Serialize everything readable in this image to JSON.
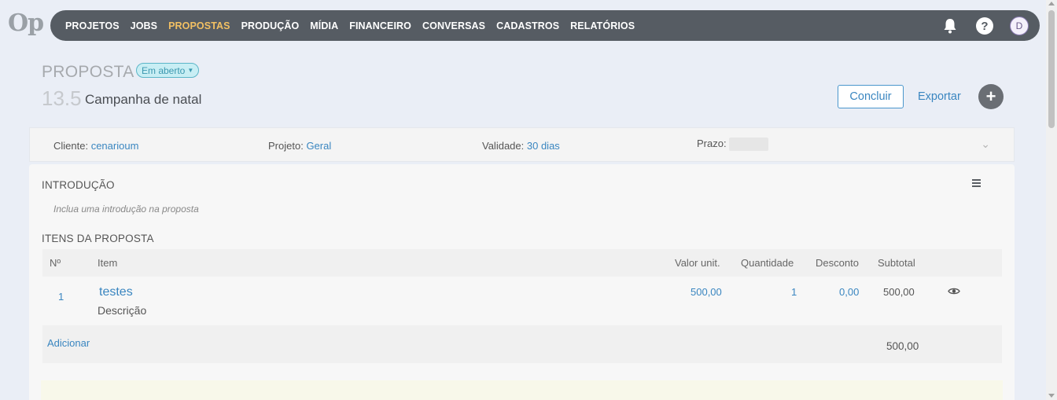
{
  "logo": {
    "text": "Op"
  },
  "nav": {
    "items": [
      {
        "label": "PROJETOS",
        "active": false
      },
      {
        "label": "JOBS",
        "active": false
      },
      {
        "label": "PROPOSTAS",
        "active": true
      },
      {
        "label": "PRODUÇÃO",
        "active": false
      },
      {
        "label": "MÍDIA",
        "active": false
      },
      {
        "label": "FINANCEIRO",
        "active": false
      },
      {
        "label": "CONVERSAS",
        "active": false
      },
      {
        "label": "CADASTROS",
        "active": false
      },
      {
        "label": "RELATÓRIOS",
        "active": false
      }
    ],
    "help_glyph": "?",
    "avatar_initial": "D"
  },
  "header": {
    "label": "PROPOSTA",
    "status": "Em aberto",
    "number": "13.5",
    "name": "Campanha de natal",
    "concluir_label": "Concluir",
    "exportar_label": "Exportar",
    "add_glyph": "+"
  },
  "info": {
    "cliente_label": "Cliente:",
    "cliente_value": "cenarioum",
    "projeto_label": "Projeto:",
    "projeto_value": "Geral",
    "validade_label": "Validade:",
    "validade_value": "30 dias",
    "prazo_label": "Prazo:"
  },
  "intro": {
    "title": "INTRODUÇÃO",
    "placeholder": "Inclua uma introdução na proposta"
  },
  "items": {
    "title": "ITENS DA PROPOSTA",
    "columns": {
      "num": "Nº",
      "item": "Item",
      "valor": "Valor unit.",
      "quantidade": "Quantidade",
      "desconto": "Desconto",
      "subtotal": "Subtotal"
    },
    "rows": [
      {
        "num": "1",
        "name": "testes",
        "description": "Descrição",
        "valor": "500,00",
        "quantidade": "1",
        "desconto": "0,00",
        "subtotal": "500,00"
      }
    ],
    "add_label": "Adicionar",
    "total": "500,00"
  },
  "colors": {
    "nav_bg": "#565c63",
    "nav_active": "#f2c063",
    "link": "#3a86c0",
    "page_bg": "#eaeef6"
  }
}
